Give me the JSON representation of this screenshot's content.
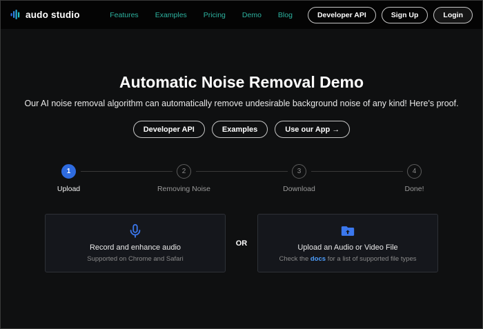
{
  "navbar": {
    "logo_text": "audo studio",
    "links": [
      {
        "label": "Features"
      },
      {
        "label": "Examples"
      },
      {
        "label": "Pricing"
      },
      {
        "label": "Demo"
      },
      {
        "label": "Blog"
      }
    ],
    "buttons": [
      {
        "label": "Developer API"
      },
      {
        "label": "Sign Up"
      },
      {
        "label": "Login"
      }
    ]
  },
  "hero": {
    "title": "Automatic Noise Removal Demo",
    "subtitle": "Our AI noise removal algorithm can automatically remove undesirable background noise of any kind! Here's proof.",
    "buttons": [
      {
        "label": "Developer API"
      },
      {
        "label": "Examples"
      },
      {
        "label": "Use our App →"
      }
    ]
  },
  "stepper": {
    "steps": [
      {
        "number": "1",
        "label": "Upload"
      },
      {
        "number": "2",
        "label": "Removing Noise"
      },
      {
        "number": "3",
        "label": "Download"
      },
      {
        "number": "4",
        "label": "Done!"
      }
    ]
  },
  "upload": {
    "or_label": "OR",
    "record_card": {
      "title": "Record and enhance audio",
      "subtitle": "Supported on Chrome and Safari"
    },
    "file_card": {
      "title": "Upload an Audio or Video File",
      "subtitle_prefix": "Check the ",
      "subtitle_link": "docs",
      "subtitle_suffix": " for a list of supported file types"
    }
  },
  "colors": {
    "nav_link_teal": "#2db3a0",
    "active_step_blue": "#2e6bdf",
    "icon_blue": "#3b78ee",
    "docs_link_blue": "#4d9fff"
  }
}
